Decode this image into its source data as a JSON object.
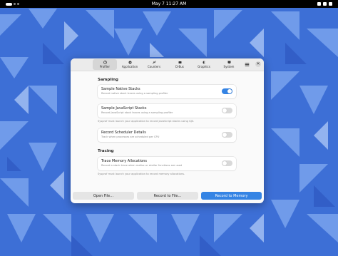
{
  "topbar": {
    "clock": "May 7  11:27 AM"
  },
  "tabs": [
    {
      "label": "Profiler",
      "icon": "profiler-icon",
      "active": true
    },
    {
      "label": "Application",
      "icon": "application-icon",
      "active": false
    },
    {
      "label": "Counters",
      "icon": "counters-icon",
      "active": false
    },
    {
      "label": "D-Bus",
      "icon": "dbus-icon",
      "active": false
    },
    {
      "label": "Graphics",
      "icon": "graphics-icon",
      "active": false
    },
    {
      "label": "System",
      "icon": "system-icon",
      "active": false
    }
  ],
  "sampling": {
    "title": "Sampling",
    "native": {
      "title": "Sample Native Stacks",
      "desc": "Record native stack traces using a sampling profiler",
      "enabled": true
    },
    "js": {
      "title": "Sample JavaScript Stacks",
      "desc": "Record JavaScript stack traces using a sampling profiler",
      "enabled": false
    },
    "js_note": "Sysprof must launch your application to record JavaScript stacks using GJS.",
    "scheduler": {
      "title": "Record Scheduler Details",
      "desc": "Track when processes are scheduled per CPU",
      "enabled": false
    }
  },
  "tracing": {
    "title": "Tracing",
    "memory": {
      "title": "Trace Memory Allocations",
      "desc": "Record a stack trace when malloc or similar functions are used",
      "enabled": false
    },
    "memory_note": "Sysprof must launch your application to record memory allocations."
  },
  "footer": {
    "open": "Open File…",
    "record_file": "Record to File…",
    "record_memory": "Record to Memory"
  },
  "colors": {
    "accent": "#3584e4",
    "wallpaper": "#3d6fd6"
  }
}
